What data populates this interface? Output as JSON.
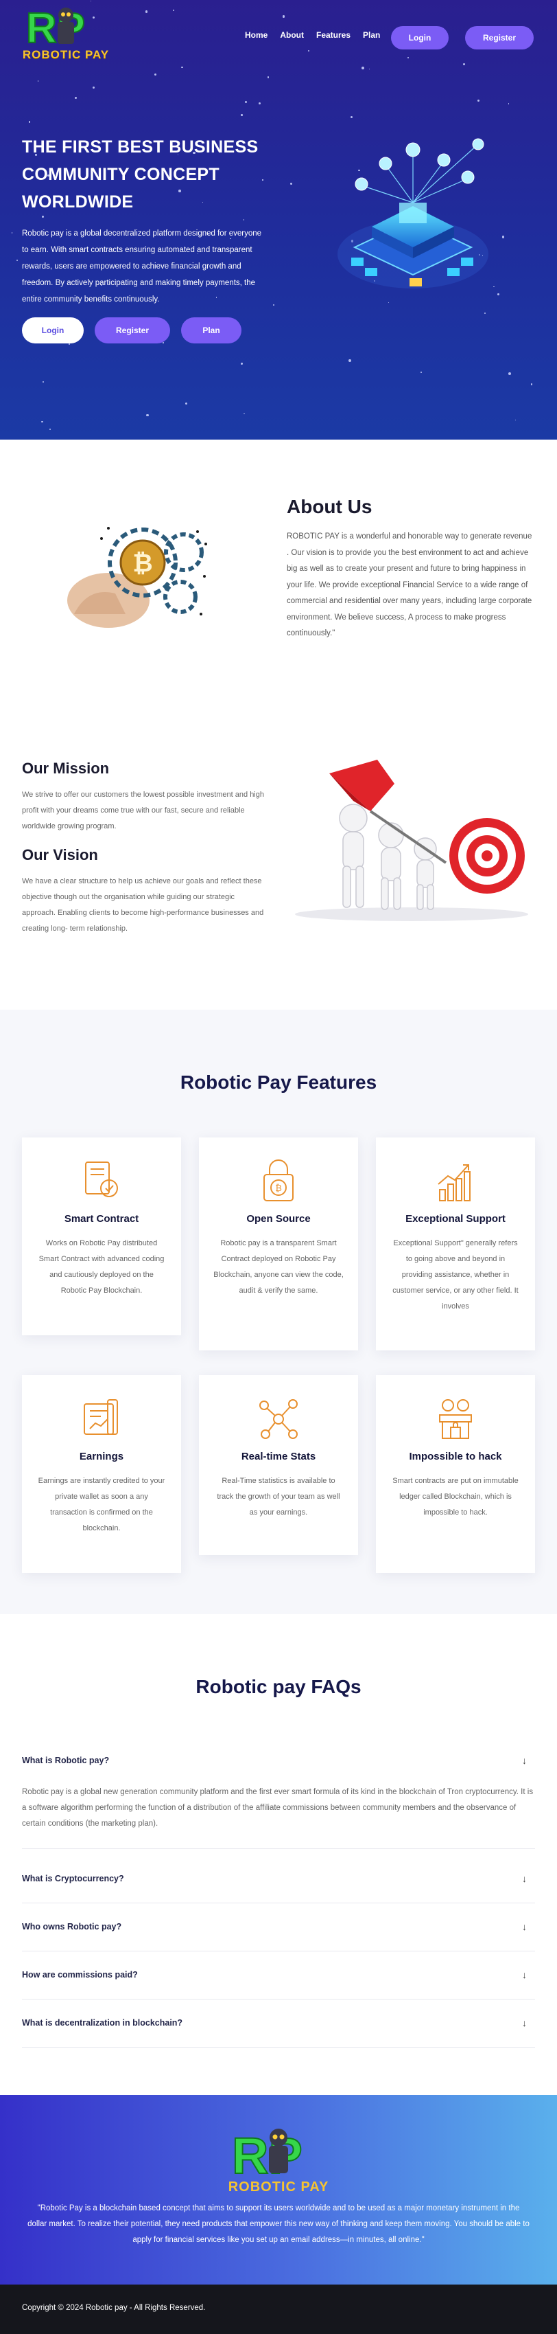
{
  "brand": {
    "letters": "RP",
    "name": "ROBOTIC PAY"
  },
  "nav": {
    "links": [
      "Home",
      "About",
      "Features",
      "Plan"
    ],
    "login": "Login",
    "register": "Register"
  },
  "hero": {
    "title": "THE FIRST BEST BUSINESS COMMUNITY CONCEPT WORLDWIDE",
    "description": "Robotic pay is a global decentralized platform designed for everyone to earn. With smart contracts ensuring automated and transparent rewards, users are empowered to achieve financial growth and freedom. By actively participating and making timely payments, the entire community benefits continuously.",
    "buttons": [
      "Login",
      "Register",
      "Plan"
    ]
  },
  "about": {
    "title": "About Us",
    "text": "ROBOTIC PAY is a wonderful and honorable way to generate revenue . Our vision is to provide you the best environment to act and achieve big as well as to create your present and future to bring happiness in your life. We provide exceptional Financial Service to a wide range of commercial and residential over many years, including large corporate environment. We believe success, A process to make progress continuously.\""
  },
  "mission": {
    "title": "Our Mission",
    "text": "We strive to offer our customers the lowest possible investment and high profit with your dreams come true with our fast, secure and reliable worldwide growing program."
  },
  "vision": {
    "title": "Our Vision",
    "text": "We have a clear structure to help us achieve our goals and reflect these objective though out the organisation while guiding our strategic approach. Enabling clients to become high-performance businesses and creating long- term relationship."
  },
  "features": {
    "title": "Robotic Pay Features",
    "accent_color": "#e8902e",
    "items": [
      {
        "icon": "smart-contract-icon",
        "title": "Smart Contract",
        "text": "Works on Robotic Pay distributed Smart Contract with advanced coding and cautiously deployed on the Robotic Pay Blockchain."
      },
      {
        "icon": "bitcoin-lock-icon",
        "title": "Open Source",
        "text": "Robotic pay is a transparent Smart Contract deployed on Robotic Pay Blockchain, anyone can view the code, audit & verify the same."
      },
      {
        "icon": "growth-chart-icon",
        "title": "Exceptional Support",
        "text": "Exceptional Support\" generally refers to going above and beyond in providing assistance, whether in customer service, or any other field. It involves"
      },
      {
        "icon": "earnings-icon",
        "title": "Earnings",
        "text": "Earnings are instantly credited to your private wallet as soon a any transaction is confirmed on the blockchain."
      },
      {
        "icon": "network-nodes-icon",
        "title": "Real-time Stats",
        "text": "Real-Time statistics is available to track the growth of your team as well as your earnings."
      },
      {
        "icon": "secure-market-icon",
        "title": "Impossible to hack",
        "text": "Smart contracts are put on immutable ledger called Blockchain, which is impossible to hack."
      }
    ]
  },
  "faq": {
    "title": "Robotic pay FAQs",
    "items": [
      {
        "question": "What is Robotic pay?",
        "answer": "Robotic pay is a global new generation community platform and the first ever smart formula of its kind in the blockchain of Tron cryptocurrency. It is a software algorithm performing the function of a distribution of the affiliate commissions between community members and the observance of certain conditions (the marketing plan)."
      },
      {
        "question": "What is Cryptocurrency?",
        "answer": ""
      },
      {
        "question": "Who owns Robotic pay?",
        "answer": ""
      },
      {
        "question": "How are commissions paid?",
        "answer": ""
      },
      {
        "question": "What is decentralization in blockchain?",
        "answer": ""
      }
    ]
  },
  "footer": {
    "text": "\"Robotic Pay is a blockchain based concept that aims to support its users worldwide and to be used as a major monetary instrument in the dollar market. To realize their potential, they need products that empower this new way of thinking and keep them moving. You should be able to apply for financial services like you set up an email address—in minutes, all online.\"",
    "copyright": "Copyright © 2024 Robotic pay - All Rights Reserved."
  }
}
